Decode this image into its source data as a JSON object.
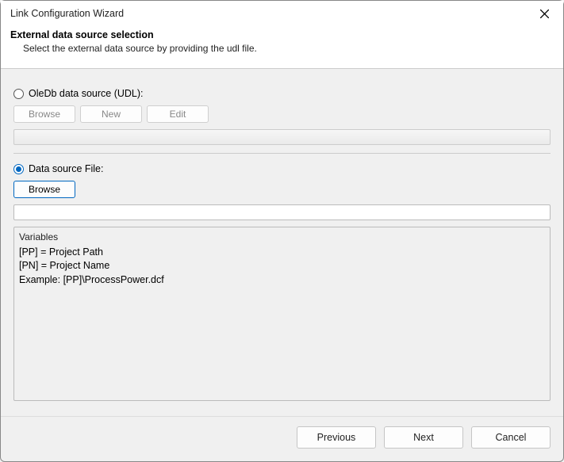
{
  "titlebar": {
    "title": "Link Configuration Wizard"
  },
  "header": {
    "heading": "External data source selection",
    "sub": "Select the external data source by providing the udl file."
  },
  "option_udl": {
    "label": "OleDb data source (UDL):",
    "browse": "Browse",
    "new": "New",
    "edit": "Edit",
    "value": ""
  },
  "option_file": {
    "label": "Data source File:",
    "browse": "Browse",
    "value": ""
  },
  "variables": {
    "title": "Variables",
    "line1": "[PP] =  Project Path",
    "line2": "[PN] =  Project Name",
    "line3": "Example: [PP]\\ProcessPower.dcf"
  },
  "footer": {
    "previous": "Previous",
    "next": "Next",
    "cancel": "Cancel"
  }
}
